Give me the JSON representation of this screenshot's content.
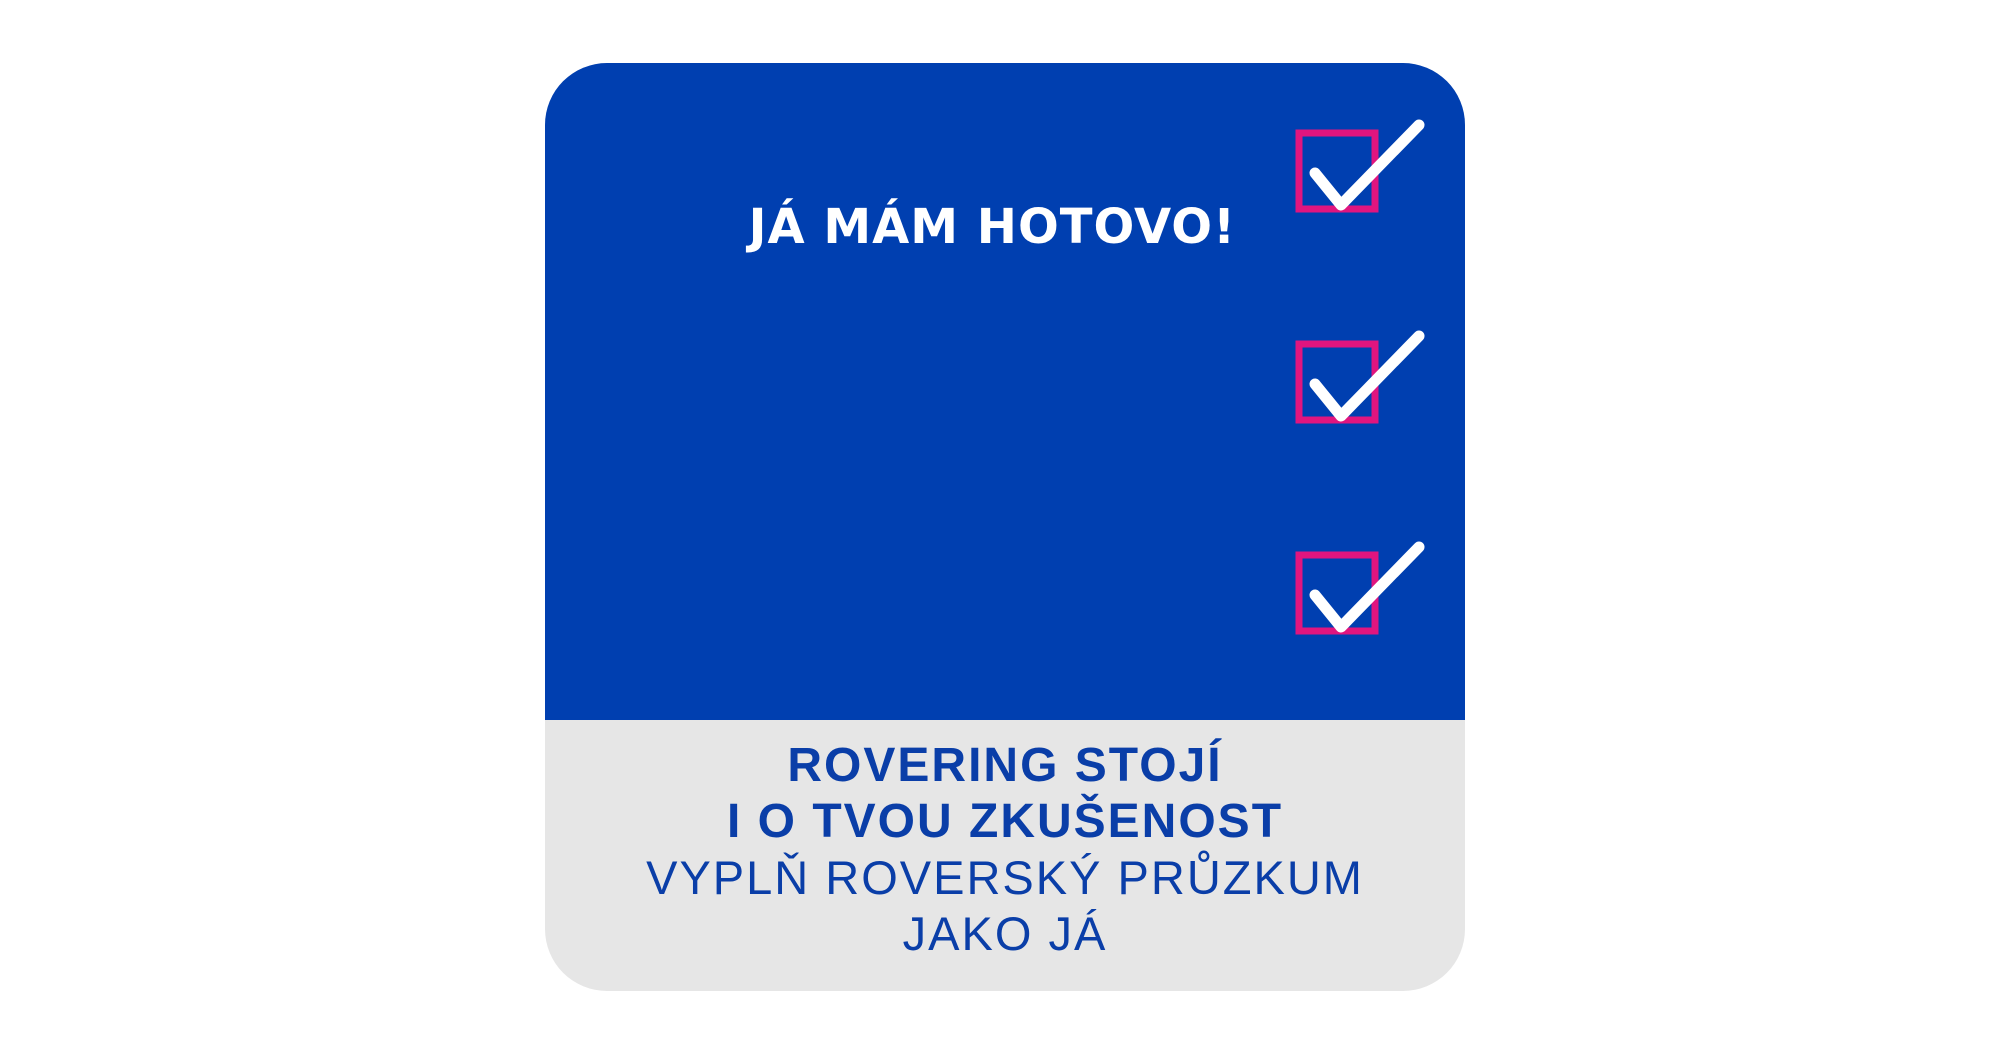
{
  "header": {
    "headline": "JÁ MÁM HOTOVO!"
  },
  "checkboxes": [
    {
      "state": "checked",
      "icon": "checkmark-icon"
    },
    {
      "state": "checked",
      "icon": "checkmark-icon"
    },
    {
      "state": "checked",
      "icon": "checkmark-icon"
    }
  ],
  "footer": {
    "line1": "ROVERING STOJÍ",
    "line2": "I O TVOU ZKUŠENOST",
    "line3": "VYPLŇ ROVERSKÝ PRŮZKUM",
    "line4": "JAKO JÁ"
  },
  "colors": {
    "blue_panel": "#003fb0",
    "grey_panel": "#e6e6e6",
    "box_magenta": "#e0157f",
    "text_blue": "#0a3ea8",
    "check_white": "#ffffff"
  }
}
